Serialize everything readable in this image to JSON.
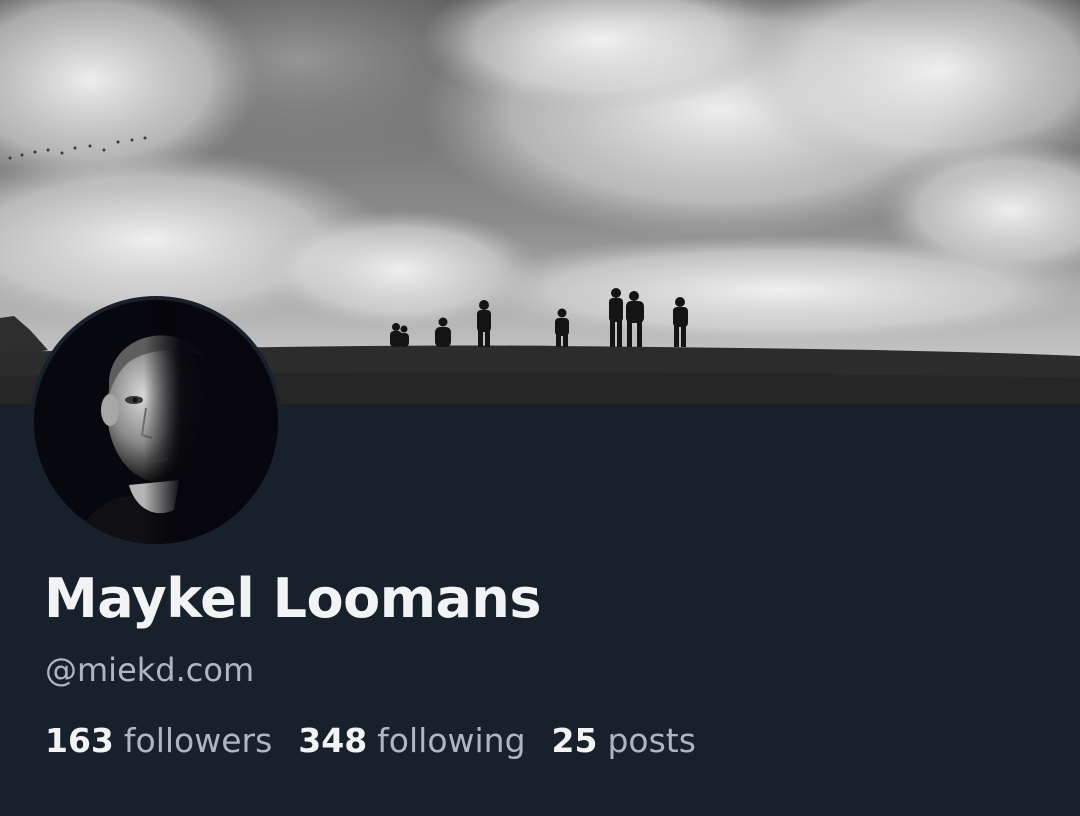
{
  "profile": {
    "display_name": "Maykel Loomans",
    "handle": "@miekd.com",
    "stats": {
      "followers": {
        "count": "163",
        "label": "followers"
      },
      "following": {
        "count": "348",
        "label": "following"
      },
      "posts": {
        "count": "25",
        "label": "posts"
      }
    }
  },
  "colors": {
    "background": "#18202c",
    "name_text": "#f1f3f5",
    "secondary_text": "#aeb6c2"
  },
  "banner": {
    "style": "grayscale",
    "subject": "people-silhouettes-on-hilltop"
  },
  "avatar": {
    "style": "grayscale-portrait"
  }
}
